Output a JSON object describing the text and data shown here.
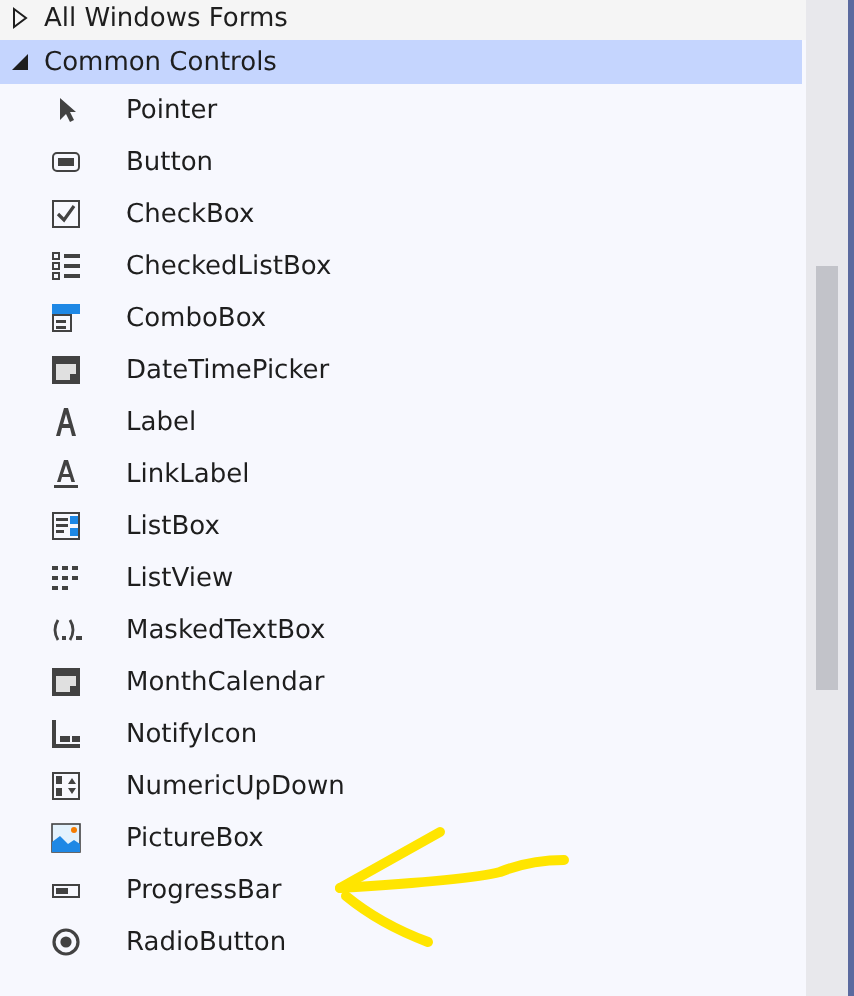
{
  "groups": [
    {
      "label": "All Windows Forms",
      "expanded": false,
      "selected": false
    },
    {
      "label": "Common Controls",
      "expanded": true,
      "selected": true,
      "items": [
        {
          "label": "Pointer"
        },
        {
          "label": "Button"
        },
        {
          "label": "CheckBox"
        },
        {
          "label": "CheckedListBox"
        },
        {
          "label": "ComboBox"
        },
        {
          "label": "DateTimePicker"
        },
        {
          "label": "Label"
        },
        {
          "label": "LinkLabel"
        },
        {
          "label": "ListBox"
        },
        {
          "label": "ListView"
        },
        {
          "label": "MaskedTextBox"
        },
        {
          "label": "MonthCalendar"
        },
        {
          "label": "NotifyIcon"
        },
        {
          "label": "NumericUpDown"
        },
        {
          "label": "PictureBox"
        },
        {
          "label": "ProgressBar"
        },
        {
          "label": "RadioButton"
        }
      ]
    }
  ]
}
